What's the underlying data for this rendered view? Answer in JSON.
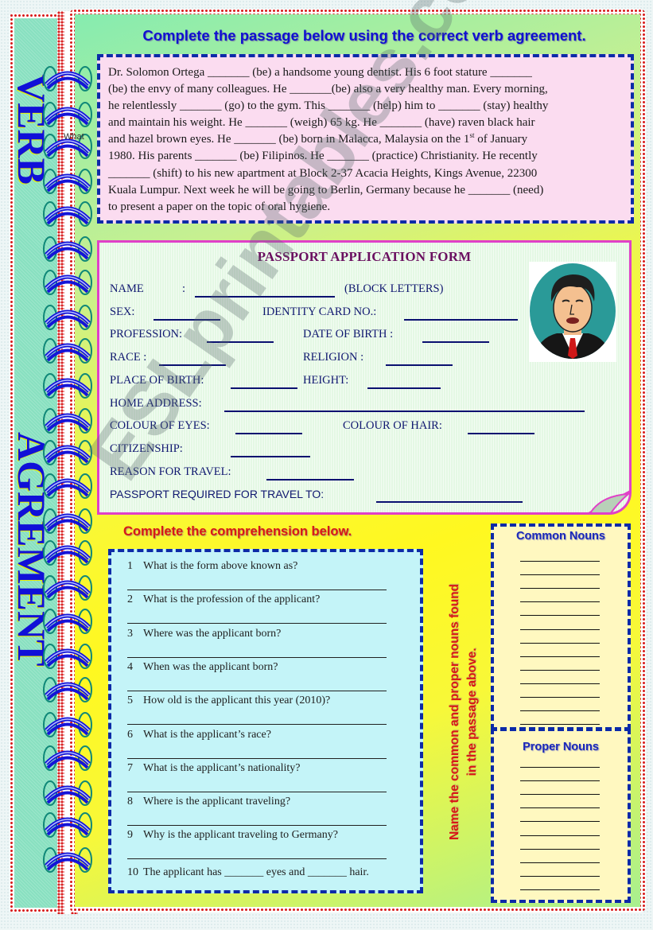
{
  "spine": {
    "word1": "VERB",
    "word2": "AGREMENT"
  },
  "stray_label": "What",
  "passage": {
    "title": "Complete the passage below using the correct verb agreement.",
    "lines": [
      "Dr. Solomon Ortega _______ (be) a handsome young dentist. His 6 foot stature _______",
      "(be) the envy of many colleagues. He _______(be) also a very healthy man. Every morning,",
      "he relentlessly _______ (go) to the gym. This _______ (help) him to _______ (stay) healthy",
      "and maintain his weight. He _______ (weigh) 65 kg. He _______ (have) raven black hair",
      "and hazel brown eyes. He _______ (be) born in Malacca, Malaysia on the 1",
      "1980. His parents _______ (be) Filipinos. He _______ (practice) Christianity. He recently",
      "_______ (shift) to his new apartment at Block 2-37 Acacia Heights, Kings Avenue, 22300",
      "Kuala Lumpur. Next week he will be going to Berlin, Germany because he _______ (need)",
      "to present a paper on the topic of oral hygiene."
    ],
    "line5_sup": "st",
    "line5_end": " of January"
  },
  "form": {
    "title": "PASSPORT APPLICATION FORM",
    "name_label": "NAME",
    "name_colon": ":",
    "block_letters": "(BLOCK  LETTERS)",
    "sex_label": "SEX:",
    "ic_label": "IDENTITY CARD NO.:",
    "profession_label": "PROFESSION:",
    "dob_label": "DATE OF BIRTH  :",
    "race_label": "RACE :",
    "religion_label": "RELIGION :",
    "pob_label": "PLACE OF BIRTH:",
    "height_label": "HEIGHT:",
    "address_label": "HOME ADDRESS:",
    "eyes_label": "COLOUR OF EYES:",
    "hair_label": "COLOUR OF HAIR:",
    "citizenship_label": "CITIZENSHIP:",
    "reason_label": "REASON FOR TRAVEL:",
    "travel_to_label": "PASSPORT REQUIRED FOR TRAVEL TO:",
    "photo": "applicant-portrait"
  },
  "comprehension": {
    "title": "Complete the comprehension below.",
    "questions": [
      {
        "n": "1",
        "text": "What is the form above known as?"
      },
      {
        "n": "2",
        "text": "What is the profession of the applicant?"
      },
      {
        "n": "3",
        "text": "Where was the applicant born?"
      },
      {
        "n": "4",
        "text": "When was the applicant born?"
      },
      {
        "n": "5",
        "text": "How old is the applicant this year (2010)?"
      },
      {
        "n": "6",
        "text": "What is the applicant’s race?"
      },
      {
        "n": "7",
        "text": "What is the applicant’s nationality?"
      },
      {
        "n": "8",
        "text": "Where is the applicant traveling?"
      },
      {
        "n": "9",
        "text": "Why is the applicant traveling to Germany?"
      }
    ],
    "q10": {
      "n": "10",
      "text": "The applicant has _______ eyes and _______ hair."
    }
  },
  "nouns": {
    "instruction_line1": "Name the common and proper nouns found",
    "instruction_line2": "in the passage above.",
    "common_title": "Common Nouns",
    "proper_title": "Proper Nouns",
    "common_lines": 13,
    "proper_lines": 10
  },
  "watermark": "ESLprintables.com",
  "colors": {
    "title_blue": "#1010d0",
    "instruction_red": "#d81818",
    "form_title": "#6a1060",
    "dash_border": "#0c2aa8",
    "passage_bg": "#fbdcf0",
    "comp_bg": "#c4f4f8",
    "nouns_bg": "#fff8c0"
  }
}
